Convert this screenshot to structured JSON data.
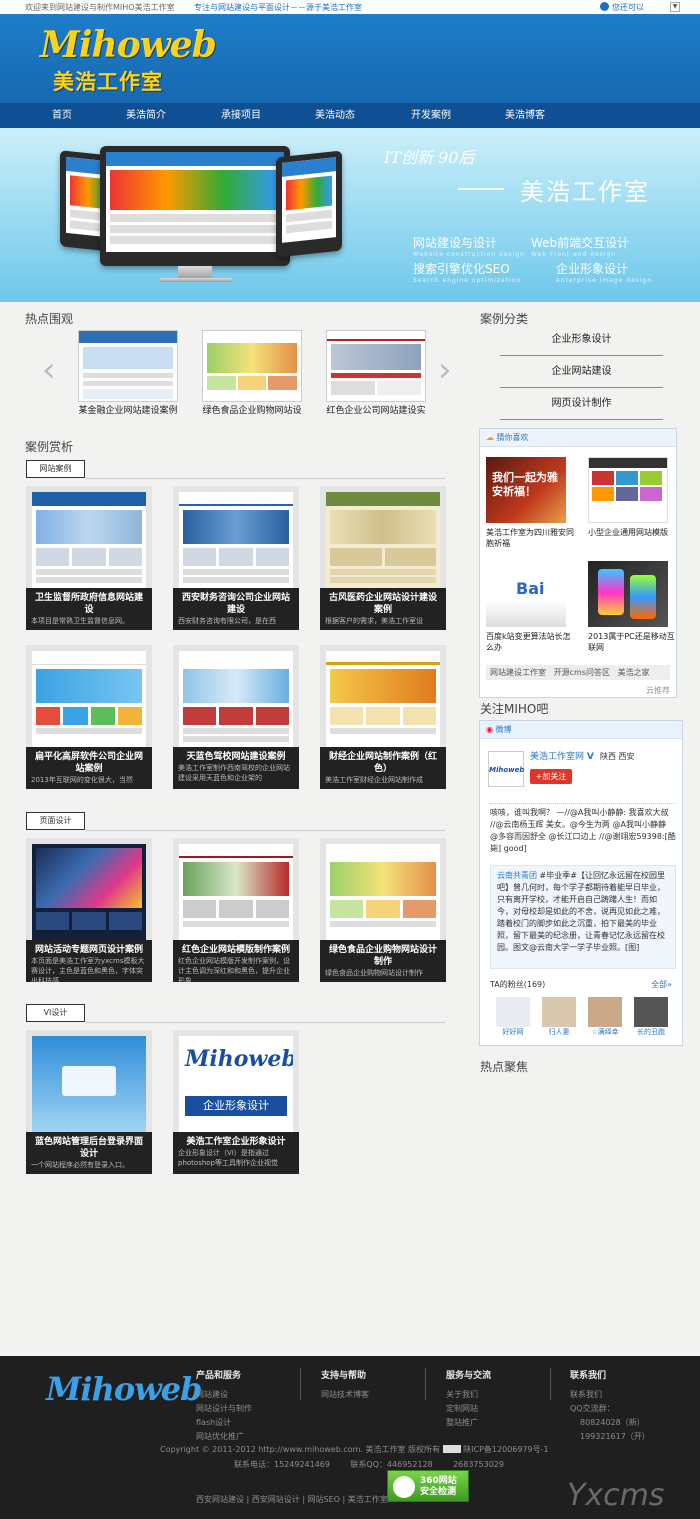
{
  "topbar": {
    "welcome": "欢迎来到网站建设与制作MIHO美浩工作室",
    "slogan": "专注与网站建设与平面设计－－源于美浩工作室",
    "login": "您还可以"
  },
  "header": {
    "logo_en": "Mihoweb",
    "logo_cn": "美浩工作室"
  },
  "nav": [
    "首页",
    "美浩简介",
    "承接项目",
    "美浩动态",
    "开发案例",
    "美浩博客"
  ],
  "banner": {
    "tagline": "IT创新  90后",
    "name": "美浩工作室",
    "services": [
      {
        "cn": "网站建设与设计",
        "en": "Website construction design"
      },
      {
        "cn": "Web前端交互设计",
        "en": "Web Front end design"
      },
      {
        "cn": "搜索引擎优化SEO",
        "en": "Search engine optimization"
      },
      {
        "cn": "企业形象设计",
        "en": "enterprise image design"
      }
    ]
  },
  "hot": {
    "title": "热点围观",
    "items": [
      "某金融企业网站建设案例",
      "绿色食品企业购物网站设",
      "红色企业公司网站建设实"
    ]
  },
  "cases": {
    "title": "案例赏析",
    "groups": [
      {
        "tag": "网站案例",
        "items": [
          {
            "title": "卫生监督所政府信息网站建设",
            "desc": "本项目是常熟卫生监督信息网。"
          },
          {
            "title": "西安财务咨询公司企业网站建设",
            "desc": "西安财务咨询有限公司，是在西"
          },
          {
            "title": "古风医药企业网站设计建设案例",
            "desc": "根据客户的需求，美浩工作室设"
          },
          {
            "title": "扁平化高屏软件公司企业网站案例",
            "desc": "2013年互联网的变化很大，当然"
          },
          {
            "title": "天蓝色驾校网站建设案例",
            "desc": "美浩工作室制作西南驾校的企业网站建设采用天蓝色和企业架的"
          },
          {
            "title": "财经企业网站制作案例（红色）",
            "desc": "美浩工作室财经企业网站制作成"
          }
        ]
      },
      {
        "tag": "页面设计",
        "items": [
          {
            "title": "网站活动专题网页设计案例",
            "desc": "本页面是美浩工作室为yxcms模板大赛设计，主色是蓝色和黑色，字体突出科技感"
          },
          {
            "title": "红色企业网站模版制作案例",
            "desc": "红色企业网站模版开发制作案例，设计主色调为深红和和黑色，提升企业形象"
          },
          {
            "title": "绿色食品企业购物网站设计制作",
            "desc": "绿色食品企业购物网站设计制作"
          }
        ]
      },
      {
        "tag": "VI设计",
        "items": [
          {
            "title": "蓝色网站管理后台登录界面设计",
            "desc": "一个网站程序必然有登录入口。"
          },
          {
            "title": "美浩工作室企业形象设计",
            "desc": "企业形象设计（VI）是指通过photoshop等工具制作企业视觉"
          }
        ]
      }
    ]
  },
  "categories": {
    "title": "案例分类",
    "items": [
      "企业形象设计",
      "企业网站建设",
      "网页设计制作"
    ]
  },
  "like": {
    "title": "猜你喜欢",
    "items": [
      {
        "caption": "美浩工作室为四川雅安同胞祈福",
        "img": "我们一起为雅安祈福！"
      },
      {
        "caption": "小型企业通用网站模版",
        "img": ""
      },
      {
        "caption": "百度k站变更算法站长怎么办",
        "img": "Bai"
      },
      {
        "caption": "2013属于PC还是移动互联网",
        "img": ""
      }
    ],
    "tags": [
      "网站建设工作室",
      "开源cms问答区",
      "美浩之家"
    ],
    "footer": "云推荐"
  },
  "weibo": {
    "title": "关注MIHO吧",
    "bar": "微博",
    "name": "美浩工作室网",
    "location": "陕西 西安",
    "follow": "+加关注",
    "post1": "咳咳，谁叫我啊？ —//@A我叫小静静: 我喜欢大叔 //@云南杨玉辉 美女。@今生为两 @A我叫小静静 @多容而因舒全 @长江口边上 //@谢翊宏59398:[酷毙] good]",
    "repost_user": "云南共青团",
    "repost": "#毕业季#【让回忆永远留在校园里吧】曾几何时，每个学子都期待着能早日毕业，只有离开学校，才能开启自己踌躇人生！而如今，对母校却是如此的不舍，说再见如此之难，踏着校门的脚步如此之沉重，拍下最美的毕业照，留下最美的纪念册，让青春记忆永远留在校园。图文@云南大学一学子毕业照。[图]",
    "fans_label": "TA的粉丝(169)",
    "fans_all": "全部»",
    "fans": [
      "好好网",
      "归人妻",
      "☆满绎幸",
      "长的丑跑"
    ]
  },
  "hotfocus": {
    "title": "热点聚焦"
  },
  "footer": {
    "logo": "Mihoweb",
    "cols": [
      {
        "title": "产品和服务",
        "links": [
          "网站建设",
          "网站设计与制作",
          "flash设计",
          "网站优化推广"
        ]
      },
      {
        "title": "支持与帮助",
        "links": [
          "网站技术博客"
        ]
      },
      {
        "title": "服务与交流",
        "links": [
          "关于我们",
          "定制网站",
          "整站推广"
        ]
      },
      {
        "title": "联系我们",
        "links": [
          "联系我们",
          "QQ交流群：",
          "80824028（新）",
          "199321617（开）"
        ]
      }
    ],
    "copyright": "Copyright © 2011-2012 http://www.mihoweb.com. 美浩工作室 版权所有",
    "icp": "陕ICP备12006979号-1",
    "contact": "联系电话：15249241469        联系QQ：446952128        2683753029",
    "badge": "360网站 安全检测",
    "links_bottom": "西安网站建设 | 西安网站设计 | 网站SEO | 美浩工作室",
    "yxcms": "Yxcms"
  },
  "colors": {
    "nav": "#0f4f93",
    "header": "#1e7dc8",
    "footer": "#1f1f1f",
    "accent": "#2c78c4"
  }
}
